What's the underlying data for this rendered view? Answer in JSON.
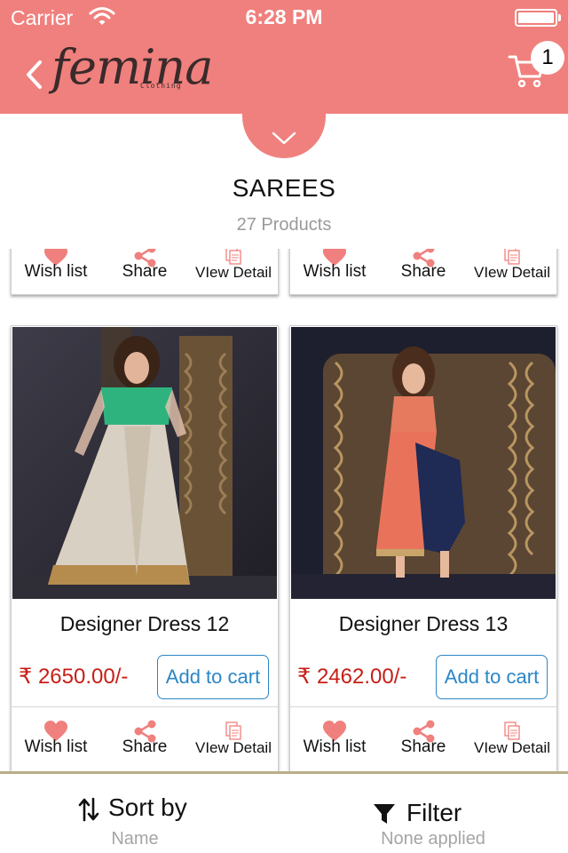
{
  "status_bar": {
    "carrier": "Carrier",
    "time": "6:28 PM"
  },
  "header": {
    "logo_text": "femina",
    "logo_subtext": "Clothing",
    "cart_count": "1",
    "bg_color": "#f0807d"
  },
  "category": {
    "title": "SAREES",
    "count": "27 Products"
  },
  "actions": {
    "wishlist": "Wish list",
    "share": "Share",
    "detail": "VIew Detail"
  },
  "products": [
    {
      "name": "Designer Dress 12",
      "price": "₹ 2650.00/-",
      "add_label": "Add to cart"
    },
    {
      "name": "Designer Dress 13",
      "price": "₹ 2462.00/-",
      "add_label": "Add to cart"
    }
  ],
  "bottom_bar": {
    "sort_label": "Sort by",
    "sort_value": "Name",
    "filter_label": "Filter",
    "filter_value": "None applied"
  },
  "colors": {
    "accent": "#f0807d",
    "price": "#c61e16",
    "link": "#2b86c5"
  }
}
